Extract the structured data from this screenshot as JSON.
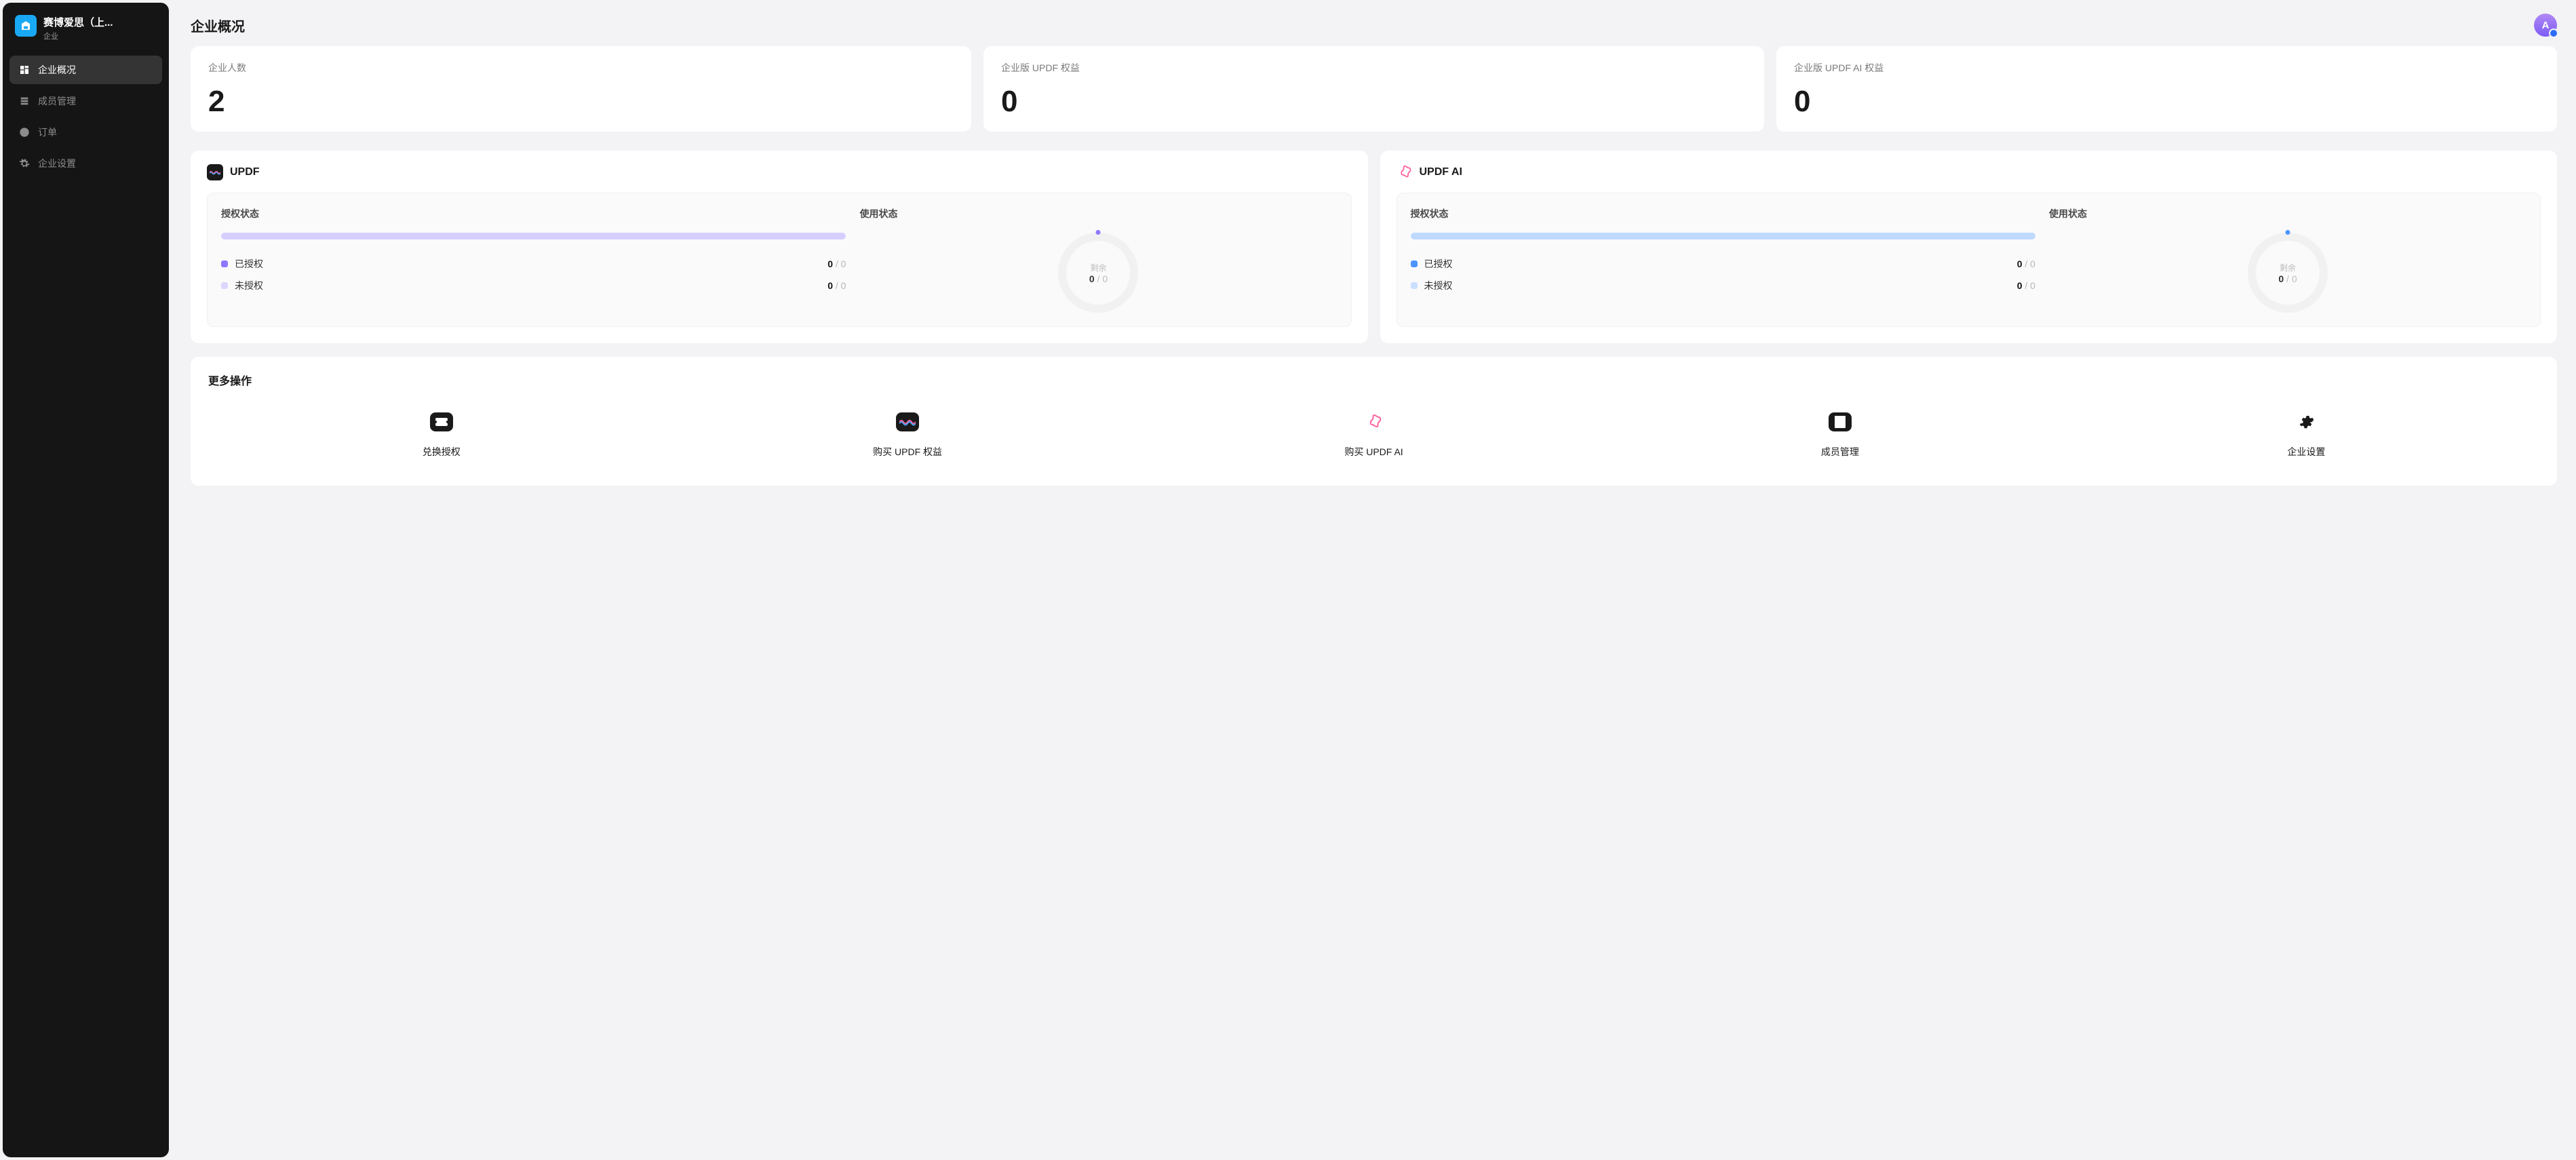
{
  "org": {
    "name": "赛博爱思（上...",
    "type": "企业"
  },
  "nav": {
    "items": [
      {
        "label": "企业概况"
      },
      {
        "label": "成员管理"
      },
      {
        "label": "订单"
      },
      {
        "label": "企业设置"
      }
    ]
  },
  "header": {
    "title": "企业概况",
    "avatar_letter": "A"
  },
  "stats": [
    {
      "label": "企业人数",
      "value": "2"
    },
    {
      "label": "企业版 UPDF 权益",
      "value": "0"
    },
    {
      "label": "企业版 UPDF AI 权益",
      "value": "0"
    }
  ],
  "products": {
    "updf": {
      "title": "UPDF",
      "auth_title": "授权状态",
      "usage_title": "使用状态",
      "authorized": {
        "label": "已授权",
        "num": "0",
        "den": "0"
      },
      "unauthorized": {
        "label": "未授权",
        "num": "0",
        "den": "0"
      },
      "remaining_label": "剩余",
      "remaining": {
        "num": "0",
        "den": "0"
      }
    },
    "updf_ai": {
      "title": "UPDF AI",
      "auth_title": "授权状态",
      "usage_title": "使用状态",
      "authorized": {
        "label": "已授权",
        "num": "0",
        "den": "0"
      },
      "unauthorized": {
        "label": "未授权",
        "num": "0",
        "den": "0"
      },
      "remaining_label": "剩余",
      "remaining": {
        "num": "0",
        "den": "0"
      }
    }
  },
  "actions": {
    "title": "更多操作",
    "items": [
      {
        "label": "兑换授权"
      },
      {
        "label": "购买 UPDF 权益"
      },
      {
        "label": "购买 UPDF AI"
      },
      {
        "label": "成员管理"
      },
      {
        "label": "企业设置"
      }
    ]
  },
  "chart_data": [
    {
      "type": "bar",
      "title": "UPDF 授权状态",
      "categories": [
        "已授权",
        "未授权"
      ],
      "values": [
        0,
        0
      ],
      "ylim": [
        0,
        0
      ]
    },
    {
      "type": "pie",
      "title": "UPDF 使用状态 — 剩余",
      "series": [
        {
          "name": "剩余",
          "values": [
            0
          ]
        }
      ],
      "total": 0
    },
    {
      "type": "bar",
      "title": "UPDF AI 授权状态",
      "categories": [
        "已授权",
        "未授权"
      ],
      "values": [
        0,
        0
      ],
      "ylim": [
        0,
        0
      ]
    },
    {
      "type": "pie",
      "title": "UPDF AI 使用状态 — 剩余",
      "series": [
        {
          "name": "剩余",
          "values": [
            0
          ]
        }
      ],
      "total": 0
    }
  ]
}
